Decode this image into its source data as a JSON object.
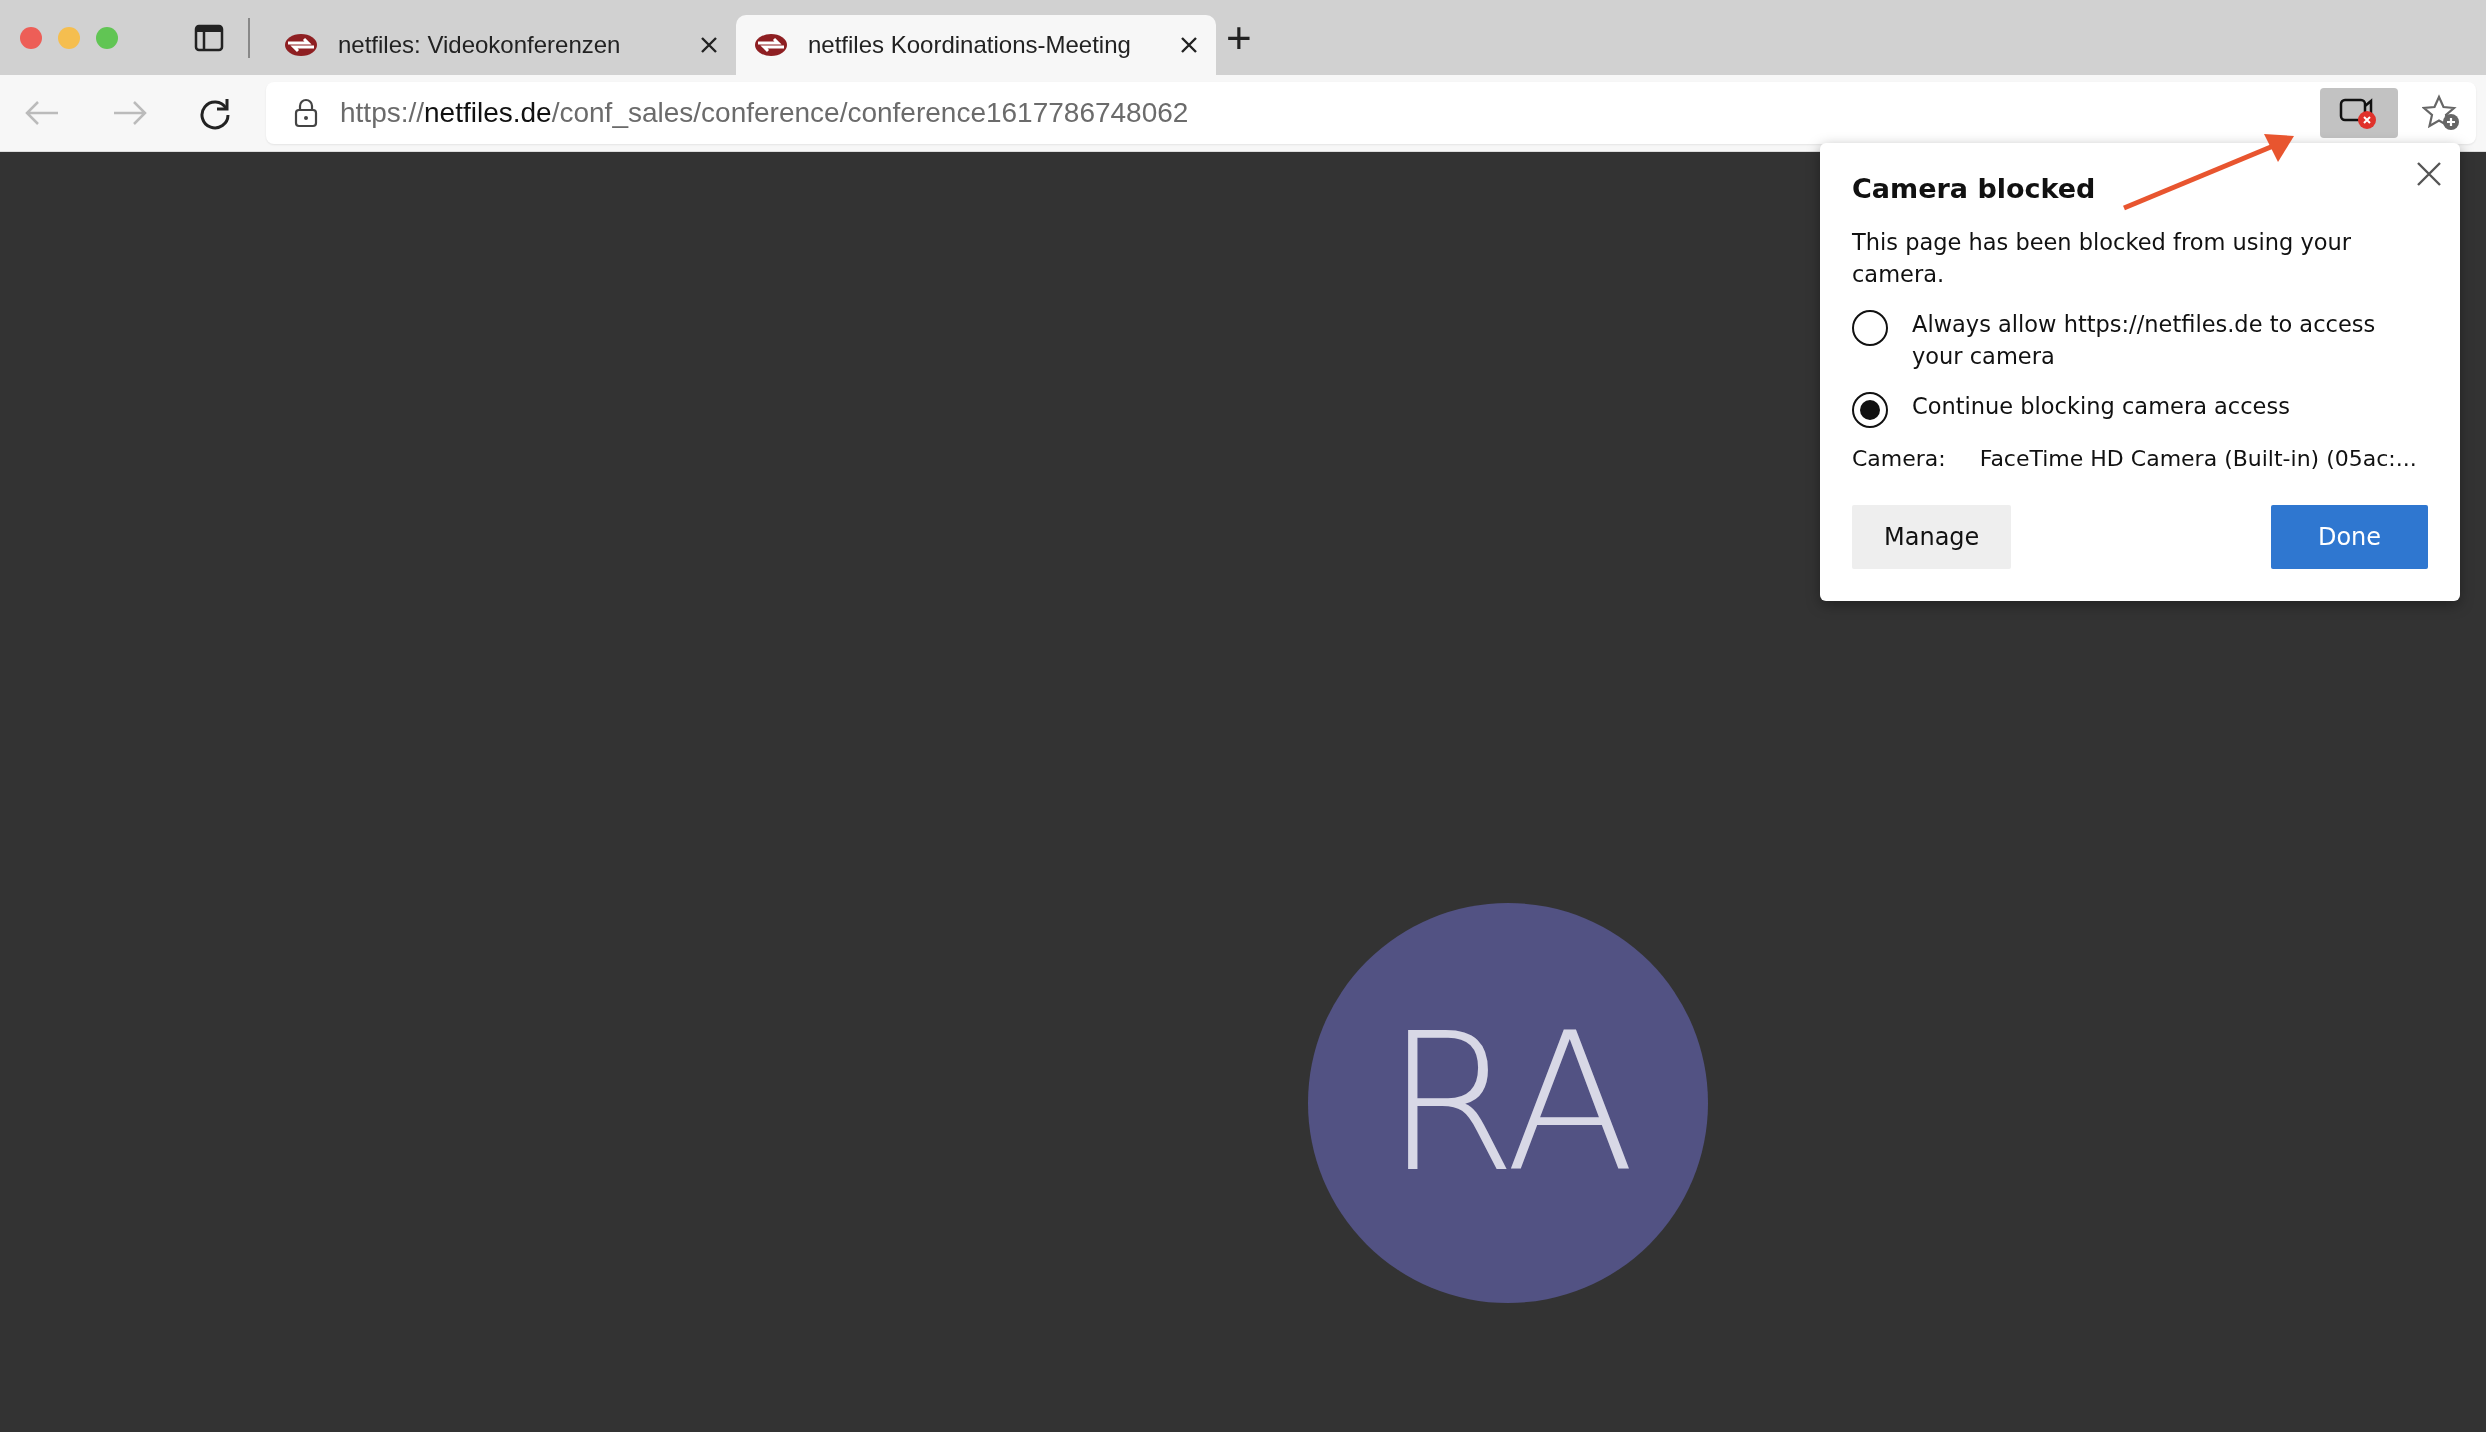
{
  "tabs": [
    {
      "title": "netfiles: Videokonferenzen",
      "selected": false
    },
    {
      "title": "netfiles Koordinations-Meeting",
      "selected": true
    }
  ],
  "new_tab": "+",
  "address_bar": {
    "scheme": "https://",
    "host": "netfiles.de",
    "path": "/conf_sales/conference/conference1617786748062"
  },
  "permission_popup": {
    "title": "Camera blocked",
    "message": "This page has been blocked from using your camera.",
    "options": [
      {
        "label": "Always allow https://netfiles.de to access your camera",
        "selected": false
      },
      {
        "label": "Continue blocking camera access",
        "selected": true
      }
    ],
    "camera_label": "Camera:",
    "camera_value": "FaceTime HD Camera (Built-in) (05ac:...",
    "buttons": [
      {
        "label": "Manage",
        "kind": "secondary"
      },
      {
        "label": "Done",
        "kind": "primary"
      }
    ]
  },
  "participant": {
    "initials": "RA"
  }
}
